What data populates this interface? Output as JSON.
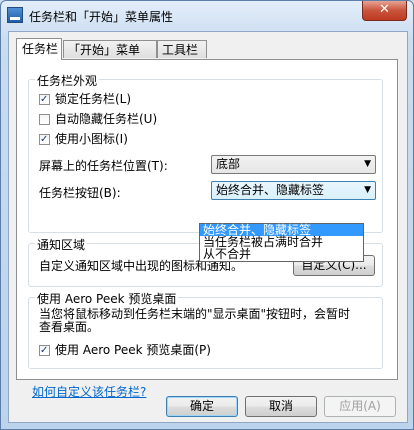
{
  "window": {
    "title": "任务栏和「开始」菜单属性",
    "close_glyph": "✕"
  },
  "tabs": [
    {
      "label": "任务栏"
    },
    {
      "label": "「开始」菜单"
    },
    {
      "label": "工具栏"
    }
  ],
  "appearance": {
    "legend": "任务栏外观",
    "lock": {
      "label": "锁定任务栏(L)",
      "checked": true
    },
    "autohide": {
      "label": "自动隐藏任务栏(U)",
      "checked": false
    },
    "small_icons": {
      "label": "使用小图标(I)",
      "checked": true
    },
    "location_label": "屏幕上的任务栏位置(T):",
    "location_value": "底部",
    "buttons_label": "任务栏按钮(B):",
    "buttons_value": "始终合并、隐藏标签",
    "buttons_options": [
      "始终合并、隐藏标签",
      "当任务栏被占满时合并",
      "从不合并"
    ]
  },
  "notification": {
    "legend": "通知区域",
    "text": "自定义通知区域中出现的图标和通知。",
    "customize_button": "自定义(C)..."
  },
  "aero": {
    "legend": "使用 Aero Peek 预览桌面",
    "desc_line1": "当您将鼠标移动到任务栏末端的\"显示桌面\"按钮时，会暂时",
    "desc_line2": "查看桌面。",
    "checkbox": {
      "label": "使用 Aero Peek 预览桌面(P)",
      "checked": true
    }
  },
  "help_link": "如何自定义该任务栏?",
  "footer": {
    "ok": "确定",
    "cancel": "取消",
    "apply": "应用(A)"
  }
}
